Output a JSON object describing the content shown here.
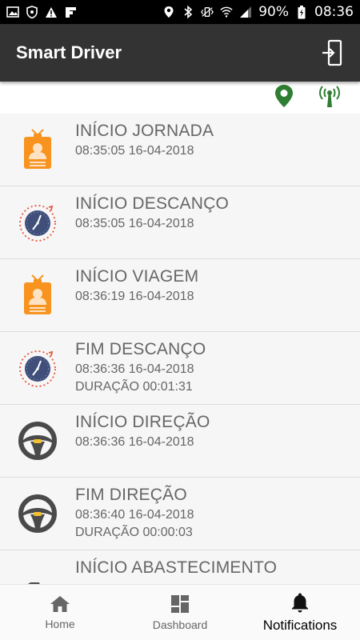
{
  "status_bar": {
    "battery": "90%",
    "time": "08:36",
    "left_icons": [
      "image-icon",
      "shield-icon",
      "warning-icon",
      "flipboard-icon"
    ],
    "right_icons": [
      "location-icon",
      "bluetooth-icon",
      "vibrate-icon",
      "wifi-icon",
      "signal-icon",
      "battery-icon"
    ]
  },
  "app_bar": {
    "title": "Smart Driver",
    "action_icon": "logout-icon"
  },
  "indicators": {
    "icons": [
      "location-pin-icon",
      "antenna-icon"
    ],
    "color": "#2e7d32"
  },
  "events": [
    {
      "title": "INÍCIO JORNADA",
      "time": "08:35:05 16-04-2018",
      "icon": "driver-badge-icon"
    },
    {
      "title": "INÍCIO DESCANÇO",
      "time": "08:35:05 16-04-2018",
      "icon": "clock-icon"
    },
    {
      "title": "INÍCIO VIAGEM",
      "time": "08:36:19 16-04-2018",
      "icon": "driver-badge-icon"
    },
    {
      "title": "FIM DESCANÇO",
      "time": "08:36:36 16-04-2018",
      "duration": "DURAÇÃO 00:01:31",
      "icon": "clock-icon"
    },
    {
      "title": "INÍCIO DIREÇÃO",
      "time": "08:36:36 16-04-2018",
      "icon": "steering-wheel-icon"
    },
    {
      "title": "FIM DIREÇÃO",
      "time": "08:36:40 16-04-2018",
      "duration": "DURAÇÃO 00:00:03",
      "icon": "steering-wheel-icon"
    },
    {
      "title": "INÍCIO ABASTECIMENTO",
      "time": "",
      "icon": "fuel-pump-icon"
    }
  ],
  "nav": [
    {
      "label": "Home",
      "icon": "home-icon",
      "active": false
    },
    {
      "label": "Dashboard",
      "icon": "dashboard-icon",
      "active": false
    },
    {
      "label": "Notifications",
      "icon": "bell-icon",
      "active": true
    }
  ],
  "colors": {
    "app_bar": "#333333",
    "badge_orange": "#f7931e",
    "clock_navy": "#3f4f7a",
    "clock_ring": "#e5563c",
    "wheel": "#4a4a4a",
    "wheel_accent": "#f2c12e"
  }
}
